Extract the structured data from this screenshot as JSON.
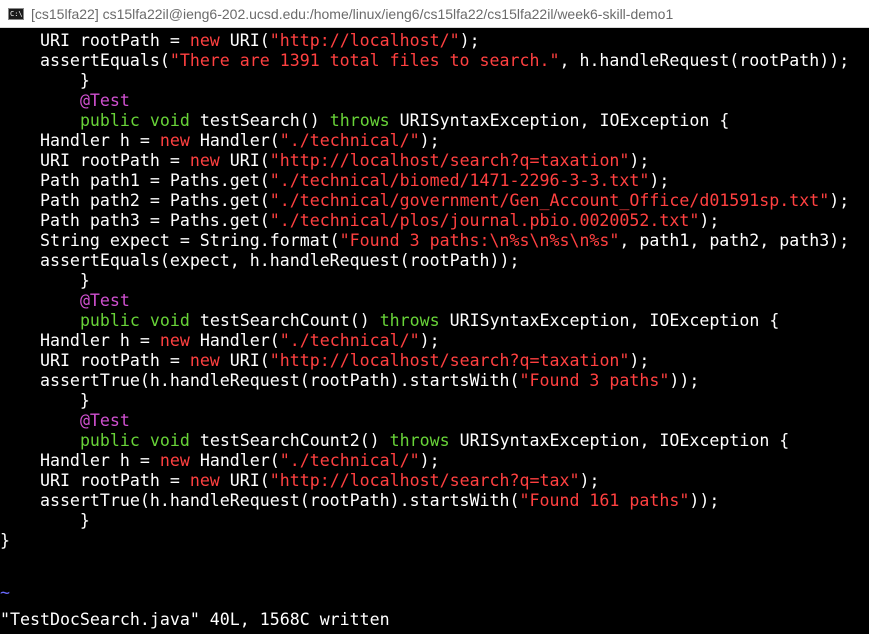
{
  "window": {
    "title": "[cs15lfa22]  cs15lfa22il@ieng6-202.ucsd.edu:/home/linux/ieng6/cs15lfa22/cs15lfa22il/week6-skill-demo1",
    "icon": "cmd-window-icon",
    "icon_text": "C:\\"
  },
  "colors": {
    "background": "#000000",
    "keyword": "#68d338",
    "string": "#ff4040",
    "annotation": "#d050d0",
    "tilde": "#6a6aff",
    "text": "#ffffff"
  },
  "editor": {
    "lines": [
      [
        {
          "t": "    URI rootPath = ",
          "c": ""
        },
        {
          "t": "new",
          "c": "new"
        },
        {
          "t": " URI(",
          "c": ""
        },
        {
          "t": "\"http://localhost/\"",
          "c": "str"
        },
        {
          "t": ");",
          "c": ""
        }
      ],
      [
        {
          "t": "    assertEquals(",
          "c": ""
        },
        {
          "t": "\"There are 1391 total files to search.\"",
          "c": "str"
        },
        {
          "t": ", h.handleRequest(rootPath));",
          "c": ""
        }
      ],
      [
        {
          "t": "        }",
          "c": ""
        }
      ],
      [
        {
          "t": "        ",
          "c": ""
        },
        {
          "t": "@Test",
          "c": "ann"
        }
      ],
      [
        {
          "t": "        ",
          "c": ""
        },
        {
          "t": "public",
          "c": "kw"
        },
        {
          "t": " ",
          "c": ""
        },
        {
          "t": "void",
          "c": "kw"
        },
        {
          "t": " testSearch() ",
          "c": ""
        },
        {
          "t": "throws",
          "c": "kw"
        },
        {
          "t": " URISyntaxException, IOException {",
          "c": ""
        }
      ],
      [
        {
          "t": "    Handler h = ",
          "c": ""
        },
        {
          "t": "new",
          "c": "new"
        },
        {
          "t": " Handler(",
          "c": ""
        },
        {
          "t": "\"./technical/\"",
          "c": "str"
        },
        {
          "t": ");",
          "c": ""
        }
      ],
      [
        {
          "t": "    URI rootPath = ",
          "c": ""
        },
        {
          "t": "new",
          "c": "new"
        },
        {
          "t": " URI(",
          "c": ""
        },
        {
          "t": "\"http://localhost/search?q=taxation\"",
          "c": "str"
        },
        {
          "t": ");",
          "c": ""
        }
      ],
      [
        {
          "t": "    Path path1 = Paths.get(",
          "c": ""
        },
        {
          "t": "\"./technical/biomed/1471-2296-3-3.txt\"",
          "c": "str"
        },
        {
          "t": ");",
          "c": ""
        }
      ],
      [
        {
          "t": "    Path path2 = Paths.get(",
          "c": ""
        },
        {
          "t": "\"./technical/government/Gen_Account_Office/d01591sp.txt\"",
          "c": "str"
        },
        {
          "t": ");",
          "c": ""
        }
      ],
      [
        {
          "t": "    Path path3 = Paths.get(",
          "c": ""
        },
        {
          "t": "\"./technical/plos/journal.pbio.0020052.txt\"",
          "c": "str"
        },
        {
          "t": ");",
          "c": ""
        }
      ],
      [
        {
          "t": "    String expect = String.format(",
          "c": ""
        },
        {
          "t": "\"Found 3 paths:\\n%s\\n%s\\n%s\"",
          "c": "str"
        },
        {
          "t": ", path1, path2, path3);",
          "c": ""
        }
      ],
      [
        {
          "t": "    assertEquals(expect, h.handleRequest(rootPath));",
          "c": ""
        }
      ],
      [
        {
          "t": "        }",
          "c": ""
        }
      ],
      [
        {
          "t": "        ",
          "c": ""
        },
        {
          "t": "@Test",
          "c": "ann"
        }
      ],
      [
        {
          "t": "        ",
          "c": ""
        },
        {
          "t": "public",
          "c": "kw"
        },
        {
          "t": " ",
          "c": ""
        },
        {
          "t": "void",
          "c": "kw"
        },
        {
          "t": " testSearchCount() ",
          "c": ""
        },
        {
          "t": "throws",
          "c": "kw"
        },
        {
          "t": " URISyntaxException, IOException {",
          "c": ""
        }
      ],
      [
        {
          "t": "    Handler h = ",
          "c": ""
        },
        {
          "t": "new",
          "c": "new"
        },
        {
          "t": " Handler(",
          "c": ""
        },
        {
          "t": "\"./technical/\"",
          "c": "str"
        },
        {
          "t": ");",
          "c": ""
        }
      ],
      [
        {
          "t": "    URI rootPath = ",
          "c": ""
        },
        {
          "t": "new",
          "c": "new"
        },
        {
          "t": " URI(",
          "c": ""
        },
        {
          "t": "\"http://localhost/search?q=taxation\"",
          "c": "str"
        },
        {
          "t": ");",
          "c": ""
        }
      ],
      [
        {
          "t": "    assertTrue(h.handleRequest(rootPath).startsWith(",
          "c": ""
        },
        {
          "t": "\"Found 3 paths\"",
          "c": "str"
        },
        {
          "t": "));",
          "c": ""
        }
      ],
      [
        {
          "t": "        }",
          "c": ""
        }
      ],
      [
        {
          "t": "        ",
          "c": ""
        },
        {
          "t": "@Test",
          "c": "ann"
        }
      ],
      [
        {
          "t": "        ",
          "c": ""
        },
        {
          "t": "public",
          "c": "kw"
        },
        {
          "t": " ",
          "c": ""
        },
        {
          "t": "void",
          "c": "kw"
        },
        {
          "t": " testSearchCount2() ",
          "c": ""
        },
        {
          "t": "throws",
          "c": "kw"
        },
        {
          "t": " URISyntaxException, IOException {",
          "c": ""
        }
      ],
      [
        {
          "t": "    Handler h = ",
          "c": ""
        },
        {
          "t": "new",
          "c": "new"
        },
        {
          "t": " Handler(",
          "c": ""
        },
        {
          "t": "\"./technical/\"",
          "c": "str"
        },
        {
          "t": ");",
          "c": ""
        }
      ],
      [
        {
          "t": "    URI rootPath = ",
          "c": ""
        },
        {
          "t": "new",
          "c": "new"
        },
        {
          "t": " URI(",
          "c": ""
        },
        {
          "t": "\"http://localhost/search?q=tax\"",
          "c": "str"
        },
        {
          "t": ");",
          "c": ""
        }
      ],
      [
        {
          "t": "    assertTrue(h.handleRequest(rootPath).startsWith(",
          "c": ""
        },
        {
          "t": "\"Found 161 paths\"",
          "c": "str"
        },
        {
          "t": "));",
          "c": ""
        }
      ],
      [
        {
          "t": "        }",
          "c": ""
        }
      ],
      [
        {
          "t": "}",
          "c": ""
        }
      ]
    ],
    "empty_line_marker": "~",
    "status_message": "\"TestDocSearch.java\" 40L, 1568C written"
  }
}
